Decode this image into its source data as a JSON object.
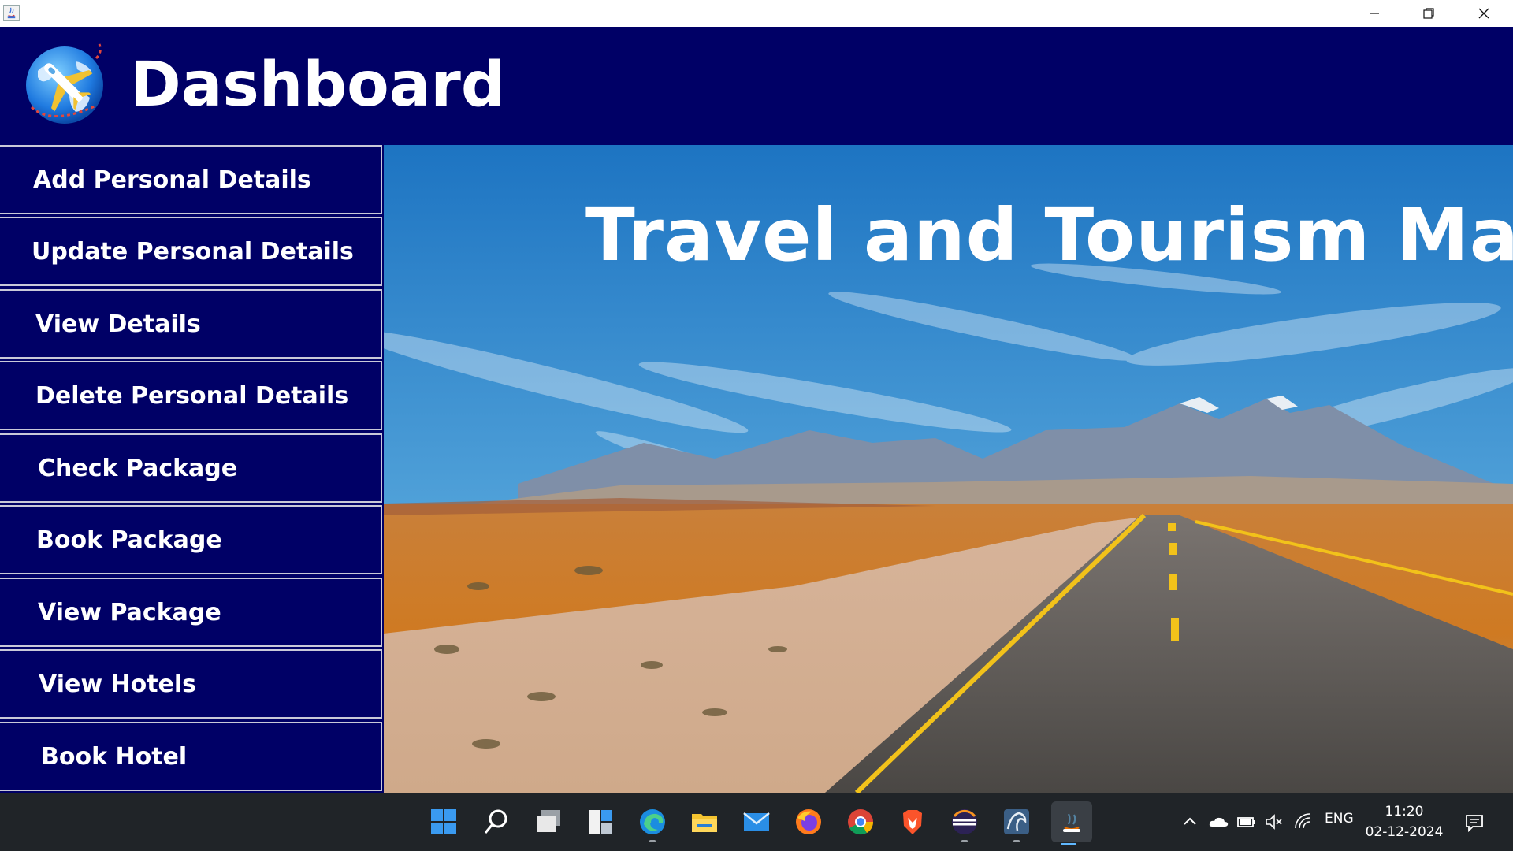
{
  "window": {
    "controls": [
      "minimize",
      "restore",
      "close"
    ]
  },
  "header": {
    "title": "Dashboard",
    "logo_icon": "globe-airplane-icon"
  },
  "sidebar": {
    "items": [
      {
        "label": "Add Personal Details"
      },
      {
        "label": "Update Personal Details"
      },
      {
        "label": "View Details"
      },
      {
        "label": "Delete Personal Details"
      },
      {
        "label": "Check Package"
      },
      {
        "label": "Book Package"
      },
      {
        "label": "View Package"
      },
      {
        "label": "View Hotels"
      },
      {
        "label": "Book Hotel"
      }
    ]
  },
  "main": {
    "headline": "Travel and Tourism Mana",
    "background": "desert-road-mountains-image"
  },
  "taskbar": {
    "apps": [
      "start-icon",
      "search-icon",
      "task-view-icon",
      "widgets-icon",
      "edge-icon",
      "file-explorer-icon",
      "mail-icon",
      "firefox-icon",
      "chrome-icon",
      "brave-icon",
      "eclipse-icon",
      "mysql-workbench-icon",
      "java-icon"
    ],
    "tray": {
      "language": "ENG",
      "time": "11:20",
      "date": "02-12-2024"
    }
  },
  "colors": {
    "navy": "#000066",
    "white": "#ffffff",
    "taskbar": "#202428"
  }
}
